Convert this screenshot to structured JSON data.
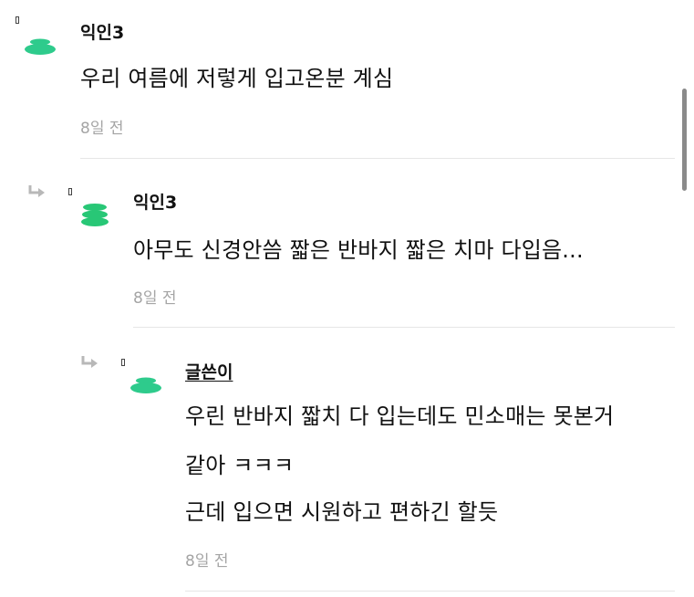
{
  "comments": [
    {
      "author": "익인3",
      "lines": [
        "우리 여름에 저렇게 입고온분 계심"
      ],
      "time": "8일 전"
    },
    {
      "author": "익인3",
      "lines": [
        "아무도 신경안씀 짧은 반바지 짧은 치마 다입음..."
      ],
      "time": "8일 전"
    },
    {
      "author": "글쓴이",
      "lines": [
        "우린 반바지 짧치 다 입는데도 민소매는 못본거",
        "같아 ㅋㅋㅋ",
        "근데 입으면 시원하고 편하긴 할듯"
      ],
      "time": "8일 전"
    }
  ],
  "colors": {
    "avatar": "#2ecb8c",
    "avatar_stack": "#28c776",
    "time": "#a5a5a5",
    "divider": "#e6e6e6",
    "scrollbar": "#8a8a8a"
  },
  "icons": [
    "reply-arrow-icon",
    "avatar-icon",
    "avatar-stack-icon"
  ]
}
